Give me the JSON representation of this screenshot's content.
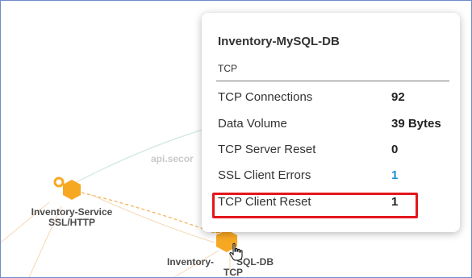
{
  "colors": {
    "node": "#f7a823",
    "highlight": "#e3161c",
    "link_value": "#1a8fd6",
    "frame": "#6f8cc9"
  },
  "topology": {
    "nodes": [
      {
        "name": "Inventory-Service",
        "protocol": "SSL/HTTP",
        "icon": "hexagon-node-icon"
      },
      {
        "name": "Inventory-MySQL-DB",
        "protocol": "TCP",
        "icon": "hexagon-node-icon"
      }
    ],
    "edge_label": "api.secor"
  },
  "tooltip": {
    "title": "Inventory-MySQL-DB",
    "subtitle": "TCP",
    "rows": [
      {
        "label": "TCP Connections",
        "value": "92"
      },
      {
        "label": "Data Volume",
        "value": "39 Bytes"
      },
      {
        "label": "TCP Server Reset",
        "value": "0"
      },
      {
        "label": "SSL Client Errors",
        "value": "1"
      },
      {
        "label": "TCP Client Reset",
        "value": "1"
      }
    ]
  },
  "cursor": {
    "icon": "hand-pointer-icon"
  },
  "node_label_partial": {
    "left": "Inventory-",
    "right": "SQL-DB"
  }
}
